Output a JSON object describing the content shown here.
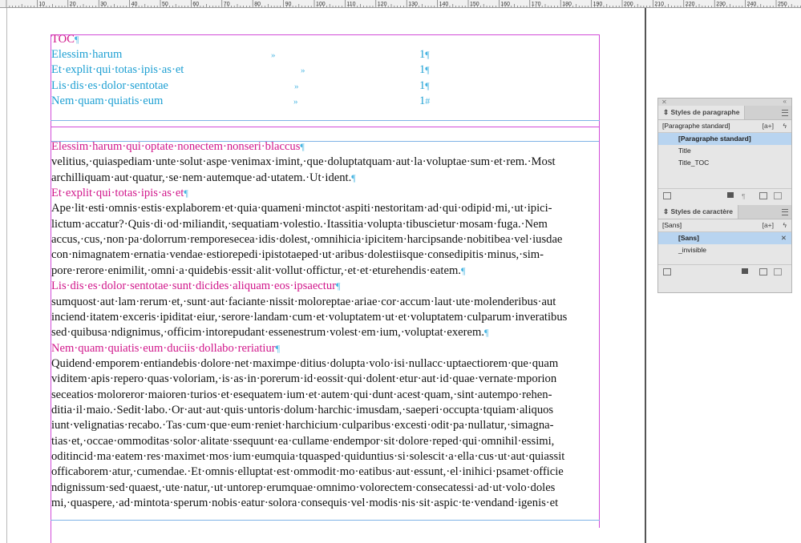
{
  "ruler": {
    "labels": [
      "10",
      "20",
      "30",
      "40",
      "50",
      "60",
      "70",
      "80",
      "90",
      "100",
      "110",
      "120",
      "130",
      "140",
      "150",
      "160",
      "170",
      "180",
      "190",
      "200",
      "210",
      "220",
      "230",
      "240",
      "250"
    ]
  },
  "toc": {
    "title": "TOC",
    "title_mark": "¶",
    "tab_mark": "»",
    "entries": [
      {
        "text": "Elessim·harum",
        "page": "1",
        "end": "¶"
      },
      {
        "text": "Et·explit·qui·totas·ipis·as·et",
        "page": "1",
        "end": "¶"
      },
      {
        "text": "Lis·dis·es·dolor·sentotae",
        "page": "1",
        "end": "¶"
      },
      {
        "text": "Nem·quam·quiatis·eum",
        "page": "1",
        "end": "#"
      }
    ]
  },
  "body": {
    "sections": [
      {
        "heading": "Elessim·harum·qui·optate·nonectem·nonseri·blaccus",
        "lines": [
          "velitius,·quiaspediam·unte·solut·aspe·venimax·imint,·que·doluptatquam·aut·la·voluptae·sum·et·rem.·Most",
          "archilliquam·aut·quatur,·se·nem·autemque·ad·utatem.·Ut·ident."
        ]
      },
      {
        "heading": "Et·explit·qui·totas·ipis·as·et",
        "lines": [
          "Ape·lit·esti·omnis·estis·explaborem·et·quia·quameni·minctot·aspiti·nestoritam·ad·qui·odipid·mi,·ut·ipici-",
          "lictum·accatur?·Quis·di·od·miliandit,·sequatiam·volestio.·Itassitia·volupta·tibuscietur·mosam·fuga.·Nem",
          "accus,·cus,·non·pa·dolorrum·remporesecea·idis·dolest,·omnihicia·ipicitem·harcipsande·nobitibea·vel·iusdae",
          "con·nimagnatem·ernatia·vendae·estiorepedi·ipistotaeped·ut·aribus·dolestiisque·consedipitis·minus,·sim-",
          "pore·rerore·enimilit,·omni·a·quidebis·essit·alit·vollut·offictur,·et·et·eturehendis·eatem."
        ]
      },
      {
        "heading": "Lis·dis·es·dolor·sentotae·sunt·dicides·aliquam·eos·ipsaectur",
        "lines": [
          "sumquost·aut·lam·rerum·et,·sunt·aut·faciante·nissit·moloreptae·ariae·cor·accum·laut·ute·molenderibus·aut",
          "inciend·itatem·exceris·ipiditat·eiur,·serore·landam·cum·et·voluptatem·ut·et·voluptatem·culparum·inveratibus",
          "sed·quibusa·ndignimus,·officim·intorepudant·essenestrum·volest·em·ium,·voluptat·exerem."
        ]
      },
      {
        "heading": "Nem·quam·quiatis·eum·duciis·dollabo·reriatiur",
        "lines": [
          "Quidend·emporem·entiandebis·dolore·net·maximpe·ditius·dolupta·volo·isi·nullacc·uptaectiorem·que·quam",
          "viditem·apis·repero·quas·voloriam,·is·as·in·porerum·id·eossit·qui·dolent·etur·aut·id·quae·vernate·mporion",
          "seceatios·moloreror·maioren·turios·et·esequatem·ium·et·autem·qui·dunt·acest·quam,·sint·autempo·rehen-",
          "ditia·il·maio.·Sedit·labo.·Or·aut·aut·quis·untoris·dolum·harchic·imusdam,·saeperi·occupta·tquiam·aliquos",
          "iunt·velignatias·recabo.·Tas·cum·que·eum·reniet·harchicium·culparibus·excesti·odit·pa·nullatur,·simagna-",
          "tias·et,·occae·ommoditas·solor·alitate·ssequunt·ea·cullame·endempor·sit·dolore·reped·qui·omnihil·essimi,",
          "oditincid·ma·eatem·res·maximet·mos·ium·eumquia·tquasped·quiduntius·si·solescit·a·ella·cus·ut·aut·quiassit",
          "officaborem·atur,·cumendae.·Et·omnis·elluptat·est·ommodit·mo·eatibus·aut·essunt,·el·inihici·psamet·officie",
          "ndignissum·sed·quaest,·ute·natur,·ut·untorep·erumquae·omnimo·volorectem·consecatessi·ad·ut·volo·doles",
          "mi,·quaspere,·ad·mintota·sperum·nobis·eatur·solora·consequis·vel·modis·nis·sit·aspic·te·vendand·igenis·et"
        ]
      }
    ],
    "pilcrow": "¶"
  },
  "panel": {
    "para_styles": {
      "tab_title": "Styles de paragraphe",
      "current": "[Paragraphe standard]",
      "badge": "[a+]",
      "items": [
        {
          "label": "[Paragraphe standard]",
          "selected": true
        },
        {
          "label": "Title",
          "selected": false
        },
        {
          "label": "Title_TOC",
          "selected": false
        }
      ]
    },
    "char_styles": {
      "tab_title": "Styles de caractère",
      "current": "[Sans]",
      "badge": "[a+]",
      "items": [
        {
          "label": "[Sans]",
          "selected": true
        },
        {
          "label": "_invisible",
          "selected": false
        }
      ]
    }
  }
}
